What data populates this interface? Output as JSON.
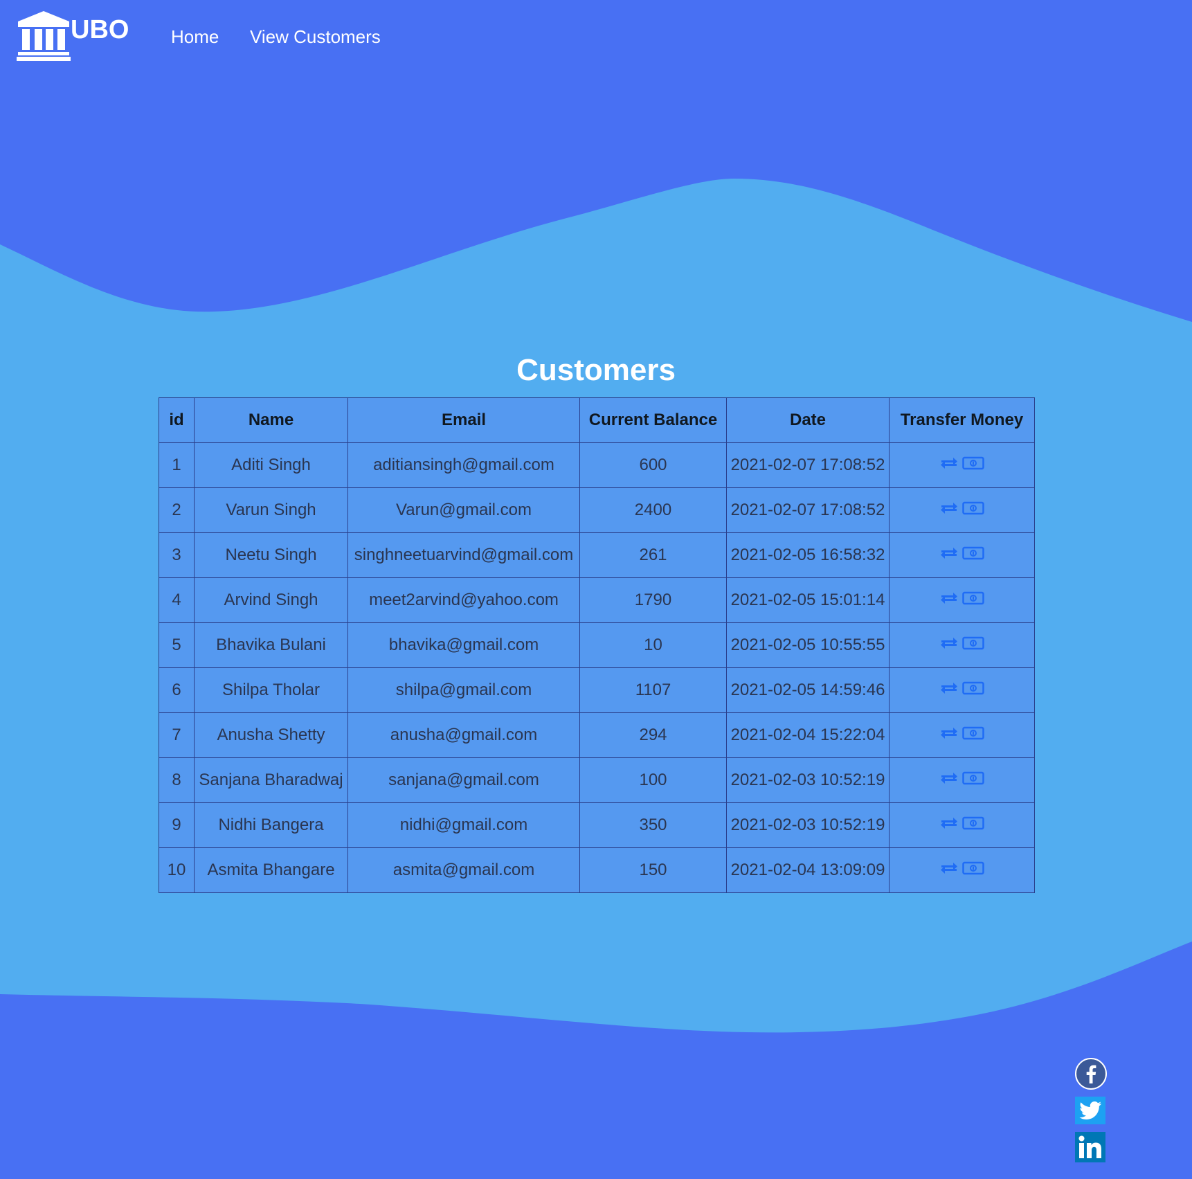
{
  "navbar": {
    "brand": "UBO",
    "brand_icon": "bank-icon",
    "links": [
      "Home",
      "View Customers"
    ]
  },
  "page": {
    "title": "Customers"
  },
  "table": {
    "columns": [
      "id",
      "Name",
      "Email",
      "Current Balance",
      "Date",
      "Transfer Money"
    ],
    "rows": [
      {
        "id": "1",
        "name": "Aditi Singh",
        "email": "aditiansingh@gmail.com",
        "balance": "600",
        "date": "2021-02-07 17:08:52"
      },
      {
        "id": "2",
        "name": "Varun Singh",
        "email": "Varun@gmail.com",
        "balance": "2400",
        "date": "2021-02-07 17:08:52"
      },
      {
        "id": "3",
        "name": "Neetu Singh",
        "email": "singhneetuarvind@gmail.com",
        "balance": "261",
        "date": "2021-02-05 16:58:32"
      },
      {
        "id": "4",
        "name": "Arvind Singh",
        "email": "meet2arvind@yahoo.com",
        "balance": "1790",
        "date": "2021-02-05 15:01:14"
      },
      {
        "id": "5",
        "name": "Bhavika Bulani",
        "email": "bhavika@gmail.com",
        "balance": "10",
        "date": "2021-02-05 10:55:55"
      },
      {
        "id": "6",
        "name": "Shilpa Tholar",
        "email": "shilpa@gmail.com",
        "balance": "1107",
        "date": "2021-02-05 14:59:46"
      },
      {
        "id": "7",
        "name": "Anusha Shetty",
        "email": "anusha@gmail.com",
        "balance": "294",
        "date": "2021-02-04 15:22:04"
      },
      {
        "id": "8",
        "name": "Sanjana Bharadwaj",
        "email": "sanjana@gmail.com",
        "balance": "100",
        "date": "2021-02-03 10:52:19"
      },
      {
        "id": "9",
        "name": "Nidhi Bangera",
        "email": "nidhi@gmail.com",
        "balance": "350",
        "date": "2021-02-03 10:52:19"
      },
      {
        "id": "10",
        "name": "Asmita Bhangare",
        "email": "asmita@gmail.com",
        "balance": "150",
        "date": "2021-02-04 13:09:09"
      }
    ],
    "action_icons": [
      "exchange-icon",
      "money-bill-icon"
    ]
  },
  "social": {
    "icons": [
      "facebook-icon",
      "twitter-icon",
      "linkedin-icon"
    ]
  },
  "colors": {
    "background": "#4870f3",
    "wave": "#52adf0",
    "table_bg": "#5599f0",
    "table_border": "#2a3f8c",
    "action_icon": "#1f6cf5",
    "text_white": "#ffffff"
  }
}
